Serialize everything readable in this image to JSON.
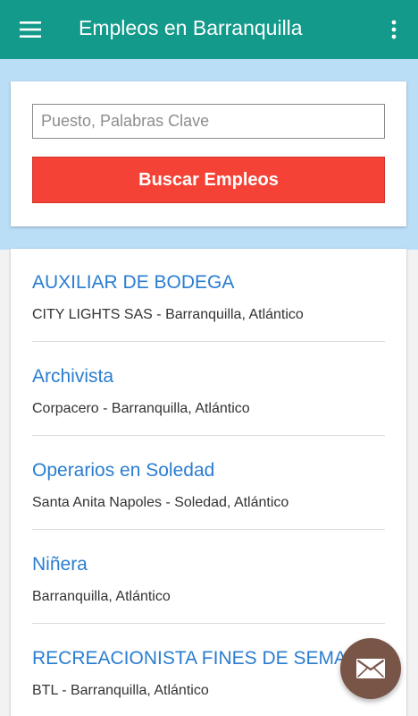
{
  "appbar": {
    "title": "Empleos en Barranquilla",
    "menu_icon": "hamburger-menu-icon",
    "overflow_icon": "more-vert-icon"
  },
  "search": {
    "placeholder": "Puesto, Palabras Clave",
    "value": "",
    "button_label": "Buscar Empleos"
  },
  "jobs": [
    {
      "title": "AUXILIAR DE BODEGA",
      "meta": "CITY LIGHTS SAS - Barranquilla, Atlántico"
    },
    {
      "title": "Archivista",
      "meta": "Corpacero - Barranquilla, Atlántico"
    },
    {
      "title": "Operarios en Soledad",
      "meta": "Santa Anita Napoles - Soledad, Atlántico"
    },
    {
      "title": "Niñera",
      "meta": "Barranquilla, Atlántico"
    },
    {
      "title": "RECREACIONISTA FINES DE SEMANA",
      "meta": "BTL - Barranquilla, Atlántico"
    }
  ],
  "fab": {
    "icon": "mail-icon"
  },
  "colors": {
    "appbar": "#139A8B",
    "band": "#BBDEF7",
    "search_button": "#F44336",
    "job_title": "#2A7DD0",
    "fab": "#795548"
  }
}
